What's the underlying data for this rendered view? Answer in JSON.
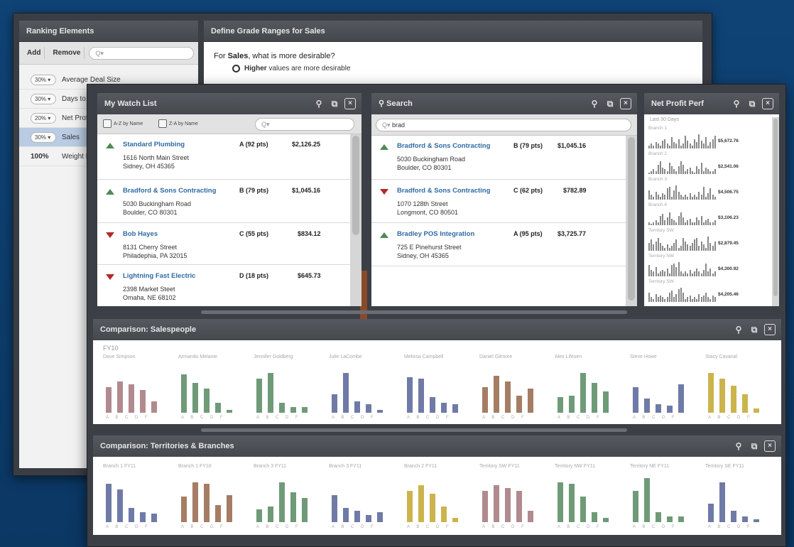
{
  "back": {
    "ranking": {
      "title": "Ranking Elements",
      "add": "Add",
      "remove": "Remove",
      "search_placeholder": "Q▾",
      "rows": [
        {
          "pct": "30% ▾",
          "label": "Average Deal Size",
          "selected": false
        },
        {
          "pct": "30% ▾",
          "label": "Days to Close",
          "selected": false
        },
        {
          "pct": "20% ▾",
          "label": "Net Profit",
          "selected": false
        },
        {
          "pct": "30% ▾",
          "label": "Sales",
          "selected": true
        }
      ],
      "total_pct": "100%",
      "total_label": "Weight Percentage"
    },
    "grade": {
      "title": "Define Grade Ranges for Sales",
      "question_prefix": "For ",
      "question_bold": "Sales",
      "question_suffix": ", what is more desirable?",
      "option_bold": "Higher",
      "option_rest": " values are more desirable"
    }
  },
  "watch": {
    "title": "My Watch List",
    "sort_az": "A-Z by Name",
    "sort_za": "Z-A by Name",
    "search_placeholder": "Q▾",
    "items": [
      {
        "trend": "up",
        "name": "Standard Plumbing",
        "addr1": "1616 North Main Street",
        "addr2": "Sidney, OH 45365",
        "grade": "A (92 pts)",
        "amount": "$2,126.25"
      },
      {
        "trend": "up",
        "name": "Bradford & Sons Contracting",
        "addr1": "5030 Buckingham Road",
        "addr2": "Boulder, CO 80301",
        "grade": "B (79 pts)",
        "amount": "$1,045.16"
      },
      {
        "trend": "down",
        "name": "Bob Hayes",
        "addr1": "8131 Cherry Street",
        "addr2": "Philadephia, PA 32015",
        "grade": "C (55 pts)",
        "amount": "$834.12"
      },
      {
        "trend": "down",
        "name": "Lightning Fast Electric",
        "addr1": "2398 Market Steet",
        "addr2": "Omaha, NE 68102",
        "grade": "D (18 pts)",
        "amount": "$645.73"
      }
    ]
  },
  "search": {
    "title": "Search",
    "query": "brad",
    "query_prefix": "Q▾",
    "items": [
      {
        "trend": "up",
        "name": "Bradford & Sons Contracting",
        "addr1": "5030 Buckingham Road",
        "addr2": "Boulder, CO 80301",
        "grade": "B (79 pts)",
        "amount": "$1,045.16"
      },
      {
        "trend": "down",
        "name": "Bradford & Sons Contracting",
        "addr1": "1070 128th Street",
        "addr2": "Longmont, CO 80501",
        "grade": "C (62 pts)",
        "amount": "$782.89"
      },
      {
        "trend": "up",
        "name": "Bradley POS Integration",
        "addr1": "725 E Pinehurst Street",
        "addr2": "Sidney, OH 45365",
        "grade": "A (95 pts)",
        "amount": "$3,725.77"
      }
    ]
  },
  "netprofit": {
    "title": "Net Profit Perf",
    "period": "Last 30 Days",
    "rows": [
      {
        "label": "Branch 1",
        "value": "$5,672.76",
        "bars": [
          2,
          3,
          2,
          4,
          3,
          2,
          5,
          6,
          3,
          2,
          7,
          4,
          3,
          6,
          2,
          3,
          8,
          5,
          3,
          2,
          6,
          4,
          9,
          5,
          3,
          7,
          2,
          4,
          6,
          8
        ]
      },
      {
        "label": "Branch 2",
        "value": "$2,541.06",
        "bars": [
          1,
          2,
          3,
          2,
          6,
          8,
          4,
          3,
          2,
          7,
          5,
          3,
          2,
          5,
          8,
          6,
          2,
          3,
          4,
          2,
          1,
          5,
          3,
          7,
          2,
          4,
          3,
          2,
          2,
          3
        ]
      },
      {
        "label": "Branch 3",
        "value": "$4,506.75",
        "bars": [
          6,
          3,
          2,
          5,
          3,
          2,
          4,
          3,
          7,
          8,
          2,
          6,
          9,
          5,
          3,
          2,
          3,
          2,
          4,
          2,
          3,
          2,
          5,
          3,
          8,
          2,
          4,
          7,
          3,
          2
        ]
      },
      {
        "label": "Branch 4",
        "value": "$3,106.23",
        "bars": [
          2,
          1,
          2,
          3,
          2,
          6,
          7,
          3,
          5,
          8,
          4,
          3,
          2,
          6,
          8,
          5,
          2,
          3,
          4,
          2,
          2,
          5,
          3,
          6,
          2,
          3,
          4,
          2,
          2,
          3
        ]
      },
      {
        "label": "Territory SW",
        "value": "$2,879.45",
        "bars": [
          5,
          7,
          4,
          6,
          8,
          5,
          3,
          2,
          4,
          2,
          3,
          5,
          7,
          2,
          3,
          8,
          6,
          4,
          3,
          5,
          7,
          8,
          3,
          6,
          4,
          2,
          9,
          5,
          3,
          6
        ]
      },
      {
        "label": "Territory NW",
        "value": "$4,300.92",
        "bars": [
          7,
          4,
          3,
          6,
          2,
          3,
          4,
          3,
          5,
          2,
          7,
          8,
          6,
          9,
          3,
          2,
          3,
          2,
          4,
          2,
          3,
          5,
          3,
          2,
          4,
          8,
          3,
          5,
          2,
          3
        ]
      },
      {
        "label": "Territory SW",
        "value": "$4,205.46",
        "bars": [
          6,
          3,
          2,
          5,
          3,
          4,
          3,
          2,
          3,
          6,
          7,
          3,
          5,
          8,
          9,
          6,
          2,
          3,
          4,
          2,
          3,
          2,
          5,
          3,
          4,
          6,
          3,
          2,
          4,
          3
        ]
      }
    ]
  },
  "comp_sales": {
    "title": "Comparison: Salespeople",
    "year": "FY10",
    "x_labels": "ABCDF",
    "groups": [
      {
        "name": "Dave Simpson",
        "color": "#b08a8e",
        "values": [
          36,
          44,
          40,
          32,
          16
        ]
      },
      {
        "name": "Armando Melanie",
        "color": "#6f9a78",
        "values": [
          54,
          42,
          34,
          14,
          4
        ]
      },
      {
        "name": "Jennifer Goldberg",
        "color": "#6f9a78",
        "values": [
          48,
          56,
          14,
          8,
          8
        ]
      },
      {
        "name": "Julie LaCombe",
        "color": "#6f7aa6",
        "values": [
          26,
          56,
          16,
          12,
          4
        ]
      },
      {
        "name": "Melissa Campbell",
        "color": "#6f7aa6",
        "values": [
          50,
          48,
          22,
          14,
          12
        ]
      },
      {
        "name": "Daniel Gilmore",
        "color": "#a57c64",
        "values": [
          36,
          52,
          44,
          24,
          34
        ]
      },
      {
        "name": "Alex Lifesen",
        "color": "#6f9a78",
        "values": [
          22,
          24,
          56,
          42,
          30
        ]
      },
      {
        "name": "Steve Howe",
        "color": "#6f7aa6",
        "values": [
          36,
          20,
          12,
          10,
          40
        ]
      },
      {
        "name": "Stacy Cavanal",
        "color": "#ccb44d",
        "values": [
          56,
          48,
          38,
          26,
          6
        ]
      }
    ]
  },
  "comp_terr": {
    "title": "Comparison: Territories & Branches",
    "x_labels": "ABCDF",
    "groups": [
      {
        "name": "Branch 1 FY11",
        "color": "#6f7aa6",
        "values": [
          54,
          46,
          20,
          14,
          12
        ]
      },
      {
        "name": "Branch 1 FY10",
        "color": "#a57c64",
        "values": [
          36,
          56,
          54,
          24,
          38
        ]
      },
      {
        "name": "Branch 3 FY11",
        "color": "#6f9a78",
        "values": [
          18,
          22,
          56,
          42,
          34
        ]
      },
      {
        "name": "Branch 3 FY11",
        "color": "#6f7aa6",
        "values": [
          38,
          20,
          16,
          10,
          14
        ]
      },
      {
        "name": "Branch 2 FY11",
        "color": "#ccb44d",
        "values": [
          44,
          52,
          40,
          22,
          6
        ]
      },
      {
        "name": "Territory SW FY11",
        "color": "#b08a8e",
        "values": [
          44,
          52,
          48,
          44,
          16
        ]
      },
      {
        "name": "Territory NW FY11",
        "color": "#6f9a78",
        "values": [
          56,
          54,
          36,
          14,
          6
        ]
      },
      {
        "name": "Territory NE FY11",
        "color": "#6f9a78",
        "values": [
          44,
          62,
          14,
          8,
          8
        ]
      },
      {
        "name": "Territory SE FY11",
        "color": "#6f7aa6",
        "values": [
          26,
          56,
          16,
          8,
          4
        ]
      }
    ]
  }
}
